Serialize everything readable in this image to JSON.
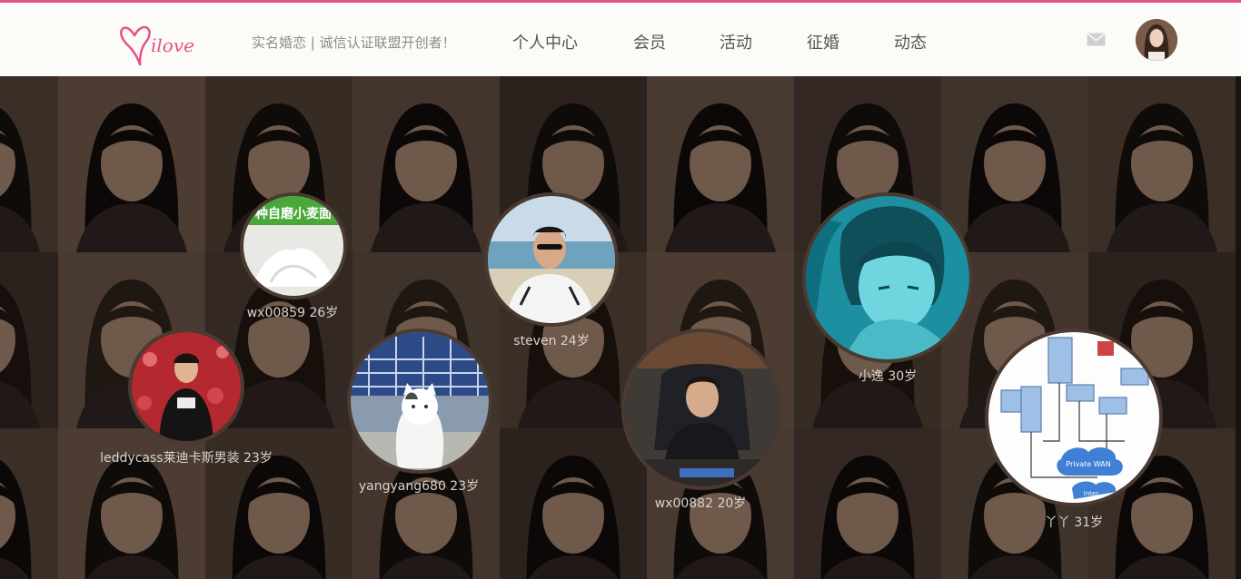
{
  "header": {
    "tagline": "实名婚恋 | 诚信认证联盟开创者！",
    "nav": [
      "个人中心",
      "会员",
      "活动",
      "征婚",
      "动态"
    ]
  },
  "colors": {
    "brand": "#e7518a",
    "header_bg": "#fbfbf7",
    "nav_text": "#555555"
  },
  "icons": {
    "mail": "mail-icon",
    "logo": "milove-heart-logo"
  },
  "members": [
    {
      "caption": "wx00859 26岁",
      "photo": "flour-product",
      "banner_text": "种自磨小麦面"
    },
    {
      "caption": "steven 24岁",
      "photo": "man-on-beach"
    },
    {
      "caption": "小逸 30岁",
      "photo": "cyan-tinted-portrait"
    },
    {
      "caption": "leddycass莱迪卡斯男装 23岁",
      "photo": "man-red-backdrop"
    },
    {
      "caption": "yangyang680 23岁",
      "photo": "white-cat-umbrella"
    },
    {
      "caption": "wx00882 20岁",
      "photo": "man-office-chair"
    },
    {
      "caption": "丫丫 31岁",
      "photo": "network-diagram",
      "diagram_labels": [
        "Private WAN",
        "Inter..."
      ]
    }
  ]
}
